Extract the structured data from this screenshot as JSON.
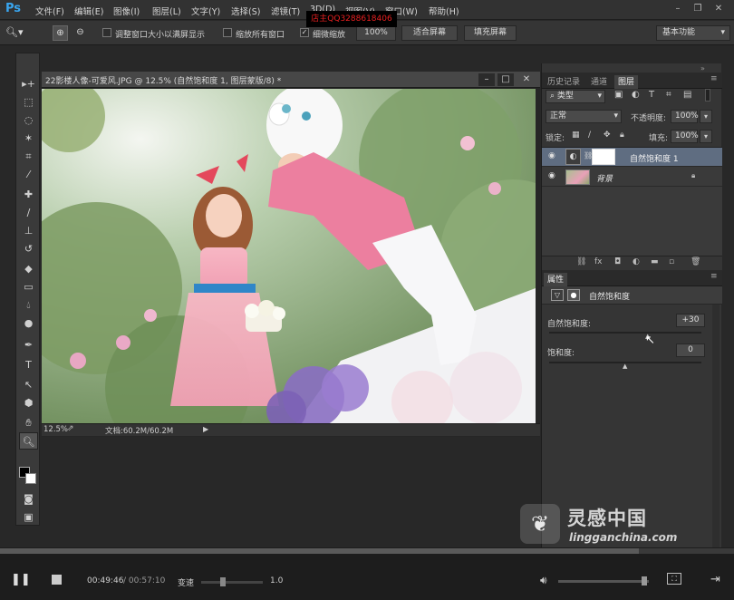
{
  "app": {
    "logo": "Ps"
  },
  "menu": [
    "文件(F)",
    "编辑(E)",
    "图像(I)",
    "图层(L)",
    "文字(Y)",
    "选择(S)",
    "滤镜(T)",
    "3D(D)",
    "视图(V)",
    "窗口(W)",
    "帮助(H)"
  ],
  "watermark_top": "店主QQ3288618406",
  "options": {
    "resize_window": "调整窗口大小以满屏显示",
    "zoom_all": "缩放所有窗口",
    "scrubby_zoom": "细微缩放",
    "zoom_value": "100%",
    "fit_screen": "适合屏幕",
    "fill_screen": "填充屏幕",
    "workspace": "基本功能"
  },
  "document": {
    "title": "22影楼人像-可爱风.JPG @ 12.5% (自然饱和度 1, 图层蒙版/8) *",
    "zoom": "12.5%",
    "doc_info": "文档:60.2M/60.2M"
  },
  "layers_panel": {
    "tabs": [
      "历史记录",
      "通道",
      "图层"
    ],
    "active_tab": "图层",
    "kind_filter": "类型",
    "blend_mode": "正常",
    "opacity_label": "不透明度:",
    "opacity_value": "100%",
    "lock_label": "锁定:",
    "fill_label": "填充:",
    "fill_value": "100%",
    "layers": [
      {
        "name": "自然饱和度 1",
        "selected": true,
        "type": "adjustment"
      },
      {
        "name": "背景",
        "selected": false,
        "type": "image",
        "locked": true
      }
    ]
  },
  "properties_panel": {
    "tab": "属性",
    "title": "自然饱和度",
    "vibrance_label": "自然饱和度:",
    "vibrance_value": "+30",
    "saturation_label": "饱和度:",
    "saturation_value": "0"
  },
  "player": {
    "current_time": "00:49:46",
    "total_time": "/ 00:57:10",
    "speed_label": "变速",
    "speed_value": "1.0",
    "progress": 0.87
  },
  "brand_watermark": {
    "name": "灵感中国",
    "url": "lingganchina.com"
  }
}
